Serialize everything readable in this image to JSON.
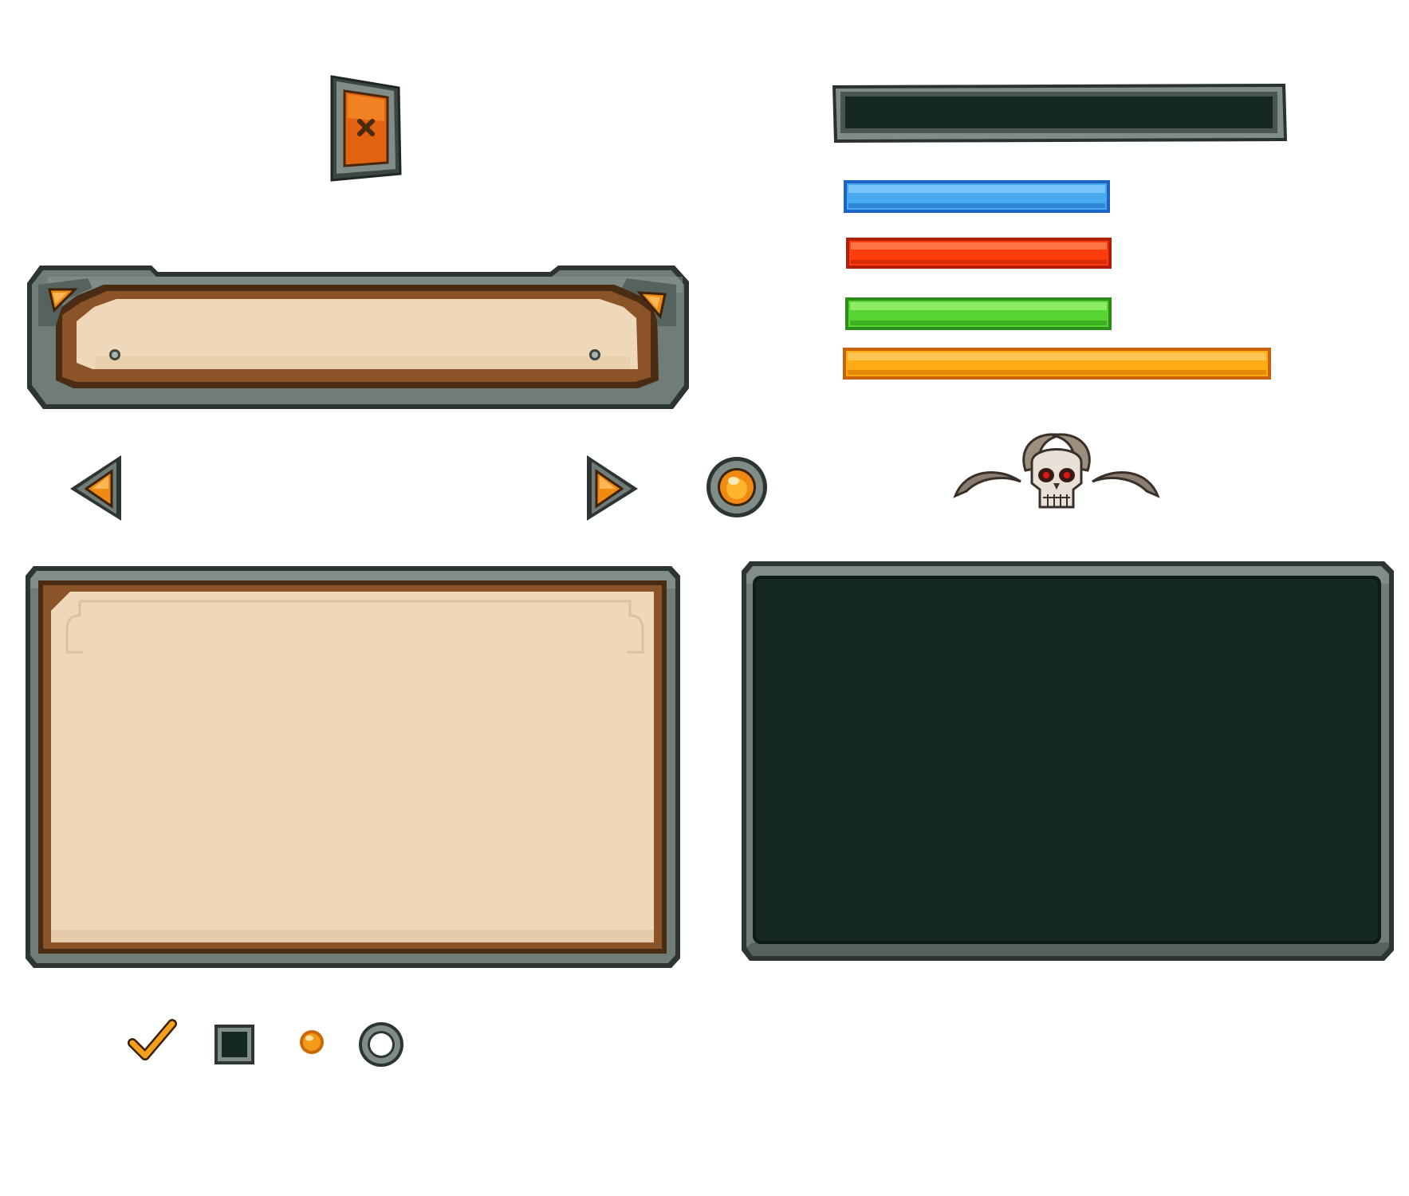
{
  "palette": {
    "stone": "#5e6b67",
    "stone_light": "#93a09b",
    "stone_dark": "#2d3532",
    "wood": "#7a4a22",
    "parchment": "#efd7ba",
    "dark_panel": "#162823",
    "orange": "#f08a12",
    "blue": "#49a9ee",
    "red": "#ff3c0c",
    "green": "#57d430",
    "amber": "#ffab14"
  },
  "icons": {
    "close": "close-icon",
    "arrow_left": "arrow-left-icon",
    "arrow_right": "arrow-right-icon",
    "orb": "orange-orb-icon",
    "skull": "horned-skull-icon",
    "check": "checkmark-icon",
    "dot": "radio-dot-icon"
  },
  "progress_bars": [
    {
      "name": "blue-bar",
      "color": "#49a9ee",
      "fill": 0.58
    },
    {
      "name": "red-bar",
      "color": "#ff3c0c",
      "fill": 0.58
    },
    {
      "name": "green-bar",
      "color": "#57d430",
      "fill": 0.58
    },
    {
      "name": "amber-bar",
      "color": "#ffab14",
      "fill": 0.94
    }
  ]
}
